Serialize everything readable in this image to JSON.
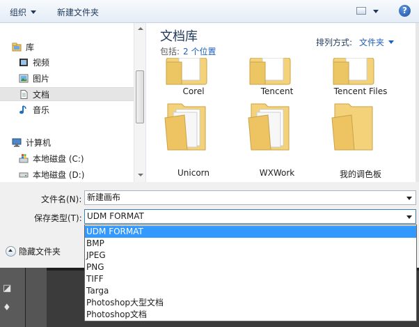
{
  "toolbar": {
    "organize": "组织",
    "new_folder": "新建文件夹",
    "help": "?"
  },
  "sidebar": {
    "items": [
      {
        "label": "库",
        "icon": "library-icon"
      },
      {
        "label": "视频",
        "icon": "video-icon"
      },
      {
        "label": "图片",
        "icon": "picture-icon"
      },
      {
        "label": "文档",
        "icon": "document-icon",
        "selected": true
      },
      {
        "label": "音乐",
        "icon": "music-icon"
      },
      {
        "label": "计算机",
        "icon": "computer-icon"
      },
      {
        "label": "本地磁盘 (C:)",
        "icon": "windows-drive-icon"
      },
      {
        "label": "本地磁盘 (D:)",
        "icon": "drive-icon"
      }
    ]
  },
  "library": {
    "title": "文档库",
    "includes_label": "包括:",
    "includes_link": "2 个位置",
    "arrange_label": "排列方式:",
    "arrange_value": "文件夹"
  },
  "folders": [
    {
      "name": "Corel"
    },
    {
      "name": "Tencent"
    },
    {
      "name": "Tencent Files"
    },
    {
      "name": "Unicorn"
    },
    {
      "name": "WXWork"
    },
    {
      "name": "我的调色板"
    }
  ],
  "form": {
    "filename_label": "文件名(N):",
    "filename_value": "新建画布",
    "filetype_label": "保存类型(T):",
    "filetype_value": "UDM FORMAT",
    "hide_folders": "隐藏文件夹"
  },
  "filetype_options": [
    "UDM FORMAT",
    "BMP",
    "JPEG",
    "PNG",
    "TIFF",
    "Targa",
    "Photoshop大型文档",
    "Photoshop文档"
  ],
  "colors": {
    "highlight": "#3399ff",
    "link": "#1f5fbf",
    "folder": "#f3d27a"
  }
}
